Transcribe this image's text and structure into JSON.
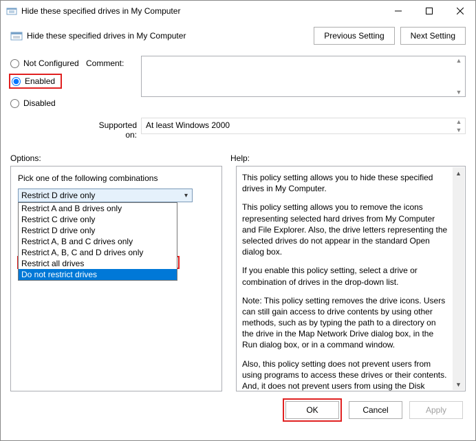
{
  "window": {
    "title": "Hide these specified drives in My Computer"
  },
  "header": {
    "subtitle": "Hide these specified drives in My Computer",
    "prev": "Previous Setting",
    "next": "Next Setting"
  },
  "config": {
    "not_configured": "Not Configured",
    "enabled": "Enabled",
    "disabled": "Disabled",
    "comment_label": "Comment:",
    "supported_label": "Supported on:",
    "supported_value": "At least Windows 2000"
  },
  "labels": {
    "options": "Options:",
    "help": "Help:"
  },
  "combo": {
    "label": "Pick one of the following combinations",
    "selected": "Restrict D drive only",
    "items": [
      "Restrict A and B drives only",
      "Restrict C drive only",
      "Restrict D drive only",
      "Restrict A, B and C drives only",
      "Restrict A, B, C and D drives only",
      "Restrict all drives",
      "Do not restrict drives"
    ]
  },
  "help": {
    "p1": "This policy setting allows you to hide these specified drives in My Computer.",
    "p2": "This policy setting allows you to remove the icons representing selected hard drives from My Computer and File Explorer. Also, the drive letters representing the selected drives do not appear in the standard Open dialog box.",
    "p3": "If you enable this policy setting, select a drive or combination of drives in the drop-down list.",
    "p4": "Note: This policy setting removes the drive icons. Users can still gain access to drive contents by using other methods, such as by typing the path to a directory on the drive in the Map Network Drive dialog box, in the Run dialog box, or in a command window.",
    "p5": "Also, this policy setting does not prevent users from using programs to access these drives or their contents. And, it does not prevent users from using the Disk Management snap-in to view and change drive characteristics."
  },
  "footer": {
    "ok": "OK",
    "cancel": "Cancel",
    "apply": "Apply"
  }
}
